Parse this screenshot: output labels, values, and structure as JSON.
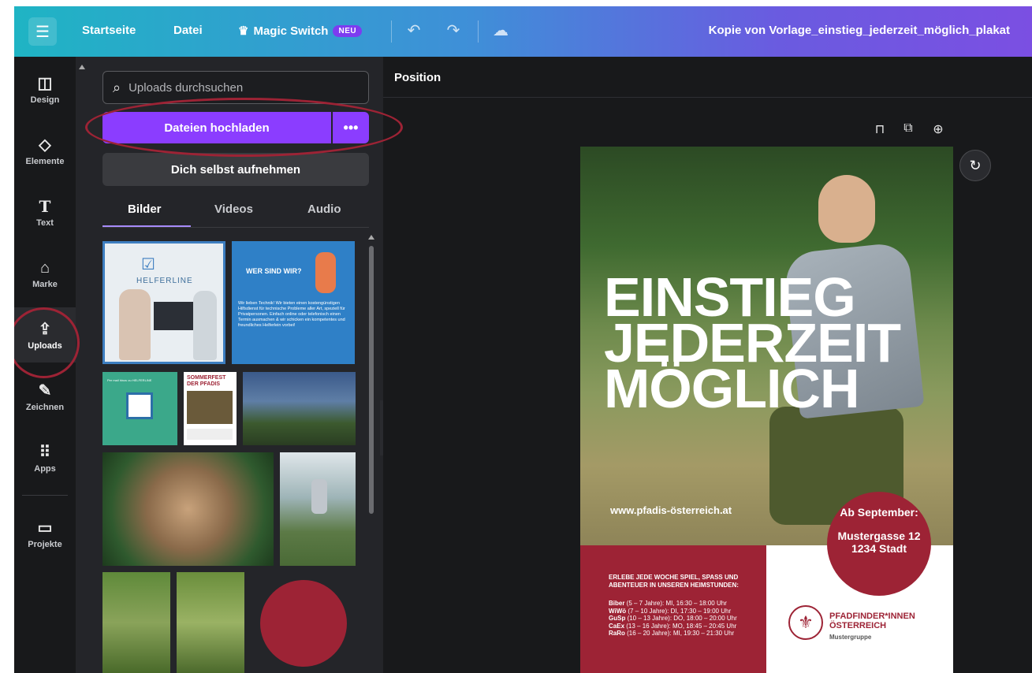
{
  "topbar": {
    "menu_icon": "hamburger-icon",
    "home": "Startseite",
    "file": "Datei",
    "magic_switch": "Magic Switch",
    "magic_icon": "crown-icon",
    "badge": "NEU",
    "undo_icon": "undo-icon",
    "redo_icon": "redo-icon",
    "cloud_icon": "cloud-check-icon",
    "doc_title": "Kopie von Vorlage_einstieg_jederzeit_möglich_plakat"
  },
  "rail": {
    "items": [
      {
        "label": "Design",
        "icon": "layout-icon"
      },
      {
        "label": "Elemente",
        "icon": "shapes-icon"
      },
      {
        "label": "Text",
        "icon": "text-icon"
      },
      {
        "label": "Marke",
        "icon": "brand-icon"
      },
      {
        "label": "Uploads",
        "icon": "cloud-upload-icon"
      },
      {
        "label": "Zeichnen",
        "icon": "draw-icon"
      },
      {
        "label": "Apps",
        "icon": "apps-grid-icon"
      },
      {
        "label": "Projekte",
        "icon": "folder-icon"
      }
    ],
    "active": "Uploads"
  },
  "panel": {
    "search_placeholder": "Uploads durchsuchen",
    "upload_button": "Dateien hochladen",
    "upload_more": "•••",
    "record_button": "Dich selbst aufnehmen",
    "tabs": [
      "Bilder",
      "Videos",
      "Audio"
    ],
    "active_tab": "Bilder",
    "thumbs": {
      "helferline_title": "HELFERLINE",
      "helferline_banner": "WER SIND WIR?",
      "helferline_text": "Wir lieben Technik! Wir bieten einen kostengünstigen Hilfsdienst für technische Probleme aller Art, speziell für Privatpersonen. Einfach online oder telefonisch einen Termin ausmachen & wir schicken ein kompetentes und freundliches Helferlein vorbei!",
      "qr_title": "Per mail hinzu zu HELFERLINE",
      "sommerfest": "SOMMERFEST DER PFADIS"
    }
  },
  "canvas": {
    "context_label": "Position",
    "lock_icon": "lock-icon",
    "duplicate_icon": "duplicate-icon",
    "add_page_icon": "add-page-icon",
    "ai_icon": "magic-refresh-icon"
  },
  "poster": {
    "headline": [
      "EINSTIEG",
      "JEDERZEIT",
      "MÖGLICH"
    ],
    "website": "www.pfadis-österreich.at",
    "circle_top": "Ab September:",
    "circle_address": "Mustergasse 12 1234 Stadt",
    "tagline": "ERLEBE JEDE WOCHE SPIEL, SPASS UND ABENTEUER IN UNSEREN HEIMSTUNDEN:",
    "schedule": [
      {
        "group": "Biber",
        "text": " (5 – 7 Jahre): MI, 16:30 – 18:00 Uhr"
      },
      {
        "group": "WiWö",
        "text": " (7 – 10 Jahre): DI, 17:30 – 19:00 Uhr"
      },
      {
        "group": "GuSp",
        "text": " (10 – 13 Jahre): DO, 18:00 – 20:00 Uhr"
      },
      {
        "group": "CaEx",
        "text": " (13 – 16 Jahre): MO, 18:45 – 20:45 Uhr"
      },
      {
        "group": "RaRo",
        "text": " (16 – 20 Jahre): MI, 19:30 – 21:30 Uhr"
      }
    ],
    "org_name": "PFADFINDER*INNEN ÖSTERREICH",
    "org_group": "Mustergruppe",
    "brand_color": "#9d2335"
  }
}
